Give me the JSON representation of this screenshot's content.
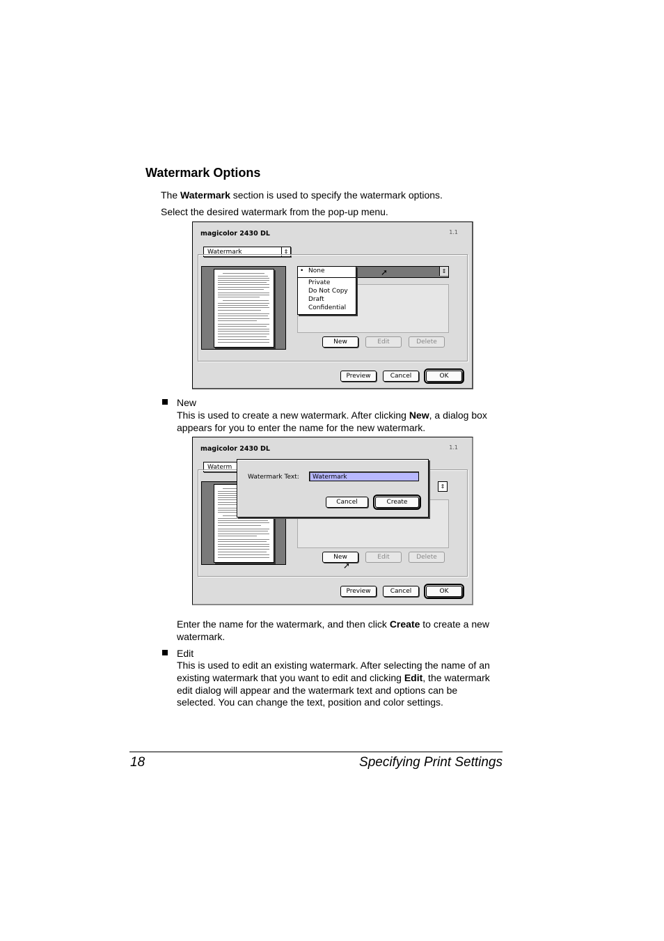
{
  "heading": "Watermark Options",
  "intro": {
    "line1_pre": "The ",
    "line1_bold": "Watermark",
    "line1_post": " section is used to specify the watermark options.",
    "line2": "Select the desired watermark from the pop-up menu."
  },
  "dialog1": {
    "title": "magicolor 2430 DL",
    "version": "1.1",
    "section_select": "Watermark",
    "menu_items": [
      "None",
      "Private",
      "Do Not Copy",
      "Draft",
      "Confidential"
    ],
    "menu_selected_marker": "•",
    "buttons": {
      "new": "New",
      "edit": "Edit",
      "delete": "Delete",
      "preview": "Preview",
      "cancel": "Cancel",
      "ok": "OK"
    }
  },
  "bullet_new": {
    "title": "New",
    "text1_pre": "This is used to create a new watermark. After clicking ",
    "text1_bold": "New",
    "text1_post": ", a dialog box",
    "text2": "appears for you to enter the name for the new watermark."
  },
  "dialog2": {
    "title": "magicolor 2430 DL",
    "version": "1.1",
    "section_select_partial": "Waterm",
    "modal_label": "Watermark Text:",
    "modal_value": "Watermark",
    "modal_cancel": "Cancel",
    "modal_create": "Create",
    "buttons": {
      "new": "New",
      "edit": "Edit",
      "delete": "Delete",
      "preview": "Preview",
      "cancel": "Cancel",
      "ok": "OK"
    }
  },
  "after_new": {
    "line1_pre": "Enter the name for the watermark, and then click ",
    "line1_bold": "Create",
    "line1_post": " to create a new",
    "line2": "watermark."
  },
  "bullet_edit": {
    "title": "Edit",
    "line1": "This is used to edit an existing watermark. After selecting the name of an",
    "line2_pre": "existing watermark that you want to edit and clicking ",
    "line2_bold": "Edit",
    "line2_post": ", the watermark",
    "line3": "edit dialog will appear and the watermark text and options can be",
    "line4": "selected. You can change the text, position and color settings."
  },
  "footer": {
    "page_number": "18",
    "section_title": "Specifying Print Settings"
  }
}
